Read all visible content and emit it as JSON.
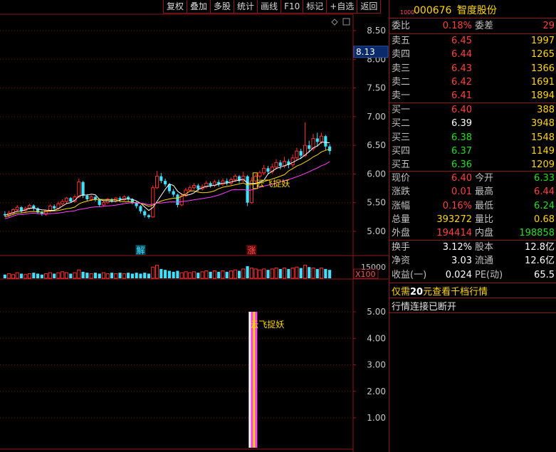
{
  "toolbar": {
    "buttons": [
      "复权",
      "叠加",
      "多股",
      "统计",
      "画线",
      "F10",
      "标记",
      "+自选",
      "返回"
    ]
  },
  "stock": {
    "code": "000676",
    "name": "智度股份",
    "small_label": "1000"
  },
  "order_book": {
    "weibi_label": "委比",
    "weibi_value": "0.18%",
    "weicha_label": "委差",
    "weicha_value": "29",
    "sells": [
      {
        "label": "卖五",
        "price": "6.45",
        "volume": "1997"
      },
      {
        "label": "卖四",
        "price": "6.44",
        "volume": "1265"
      },
      {
        "label": "卖三",
        "price": "6.43",
        "volume": "1366"
      },
      {
        "label": "卖二",
        "price": "6.42",
        "volume": "1691"
      },
      {
        "label": "卖一",
        "price": "6.41",
        "volume": "1894"
      }
    ],
    "buys": [
      {
        "label": "买一",
        "price": "6.40",
        "volume": "388",
        "color": "#ff4040"
      },
      {
        "label": "买二",
        "price": "6.39",
        "volume": "3948",
        "color": "#ffffff"
      },
      {
        "label": "买三",
        "price": "6.38",
        "volume": "1548",
        "color": "#20e020"
      },
      {
        "label": "买四",
        "price": "6.37",
        "volume": "1149",
        "color": "#20e020"
      },
      {
        "label": "买五",
        "price": "6.36",
        "volume": "1209",
        "color": "#20e020"
      }
    ]
  },
  "stats": [
    {
      "l1": "现价",
      "v1": "6.40",
      "c1": "#ff4040",
      "l2": "今开",
      "v2": "6.33",
      "c2": "#20e020"
    },
    {
      "l1": "涨跌",
      "v1": "0.01",
      "c1": "#ff4040",
      "l2": "最高",
      "v2": "6.44",
      "c2": "#ff4040"
    },
    {
      "l1": "涨幅",
      "v1": "0.16%",
      "c1": "#ff4040",
      "l2": "最低",
      "v2": "6.24",
      "c2": "#20e020"
    },
    {
      "l1": "总量",
      "v1": "393272",
      "c1": "#ffd700",
      "l2": "量比",
      "v2": "0.68",
      "c2": "#ffd700"
    },
    {
      "l1": "外盘",
      "v1": "194414",
      "c1": "#ff4040",
      "l2": "内盘",
      "v2": "198858",
      "c2": "#20e020"
    }
  ],
  "stats2": [
    {
      "l1": "换手",
      "v1": "3.12%",
      "l2": "股本",
      "v2": "12.8亿"
    },
    {
      "l1": "净资",
      "v1": "3.03",
      "l2": "流通",
      "v2": "12.6亿"
    },
    {
      "l1": "收益(一)",
      "v1": "0.024",
      "l2": "PE(动)",
      "v2": "65.5"
    }
  ],
  "notices": {
    "promo_prefix": "仅需",
    "promo_amount": "20",
    "promo_suffix": "元查看千档行情",
    "connection": "行情连接已断开"
  },
  "chart": {
    "price_ticks": [
      "8.50",
      "8.00",
      "7.50",
      "7.00",
      "6.50",
      "6.00",
      "5.50",
      "5.00"
    ],
    "cursor_price": "8.13",
    "volume_tick": "15000",
    "volume_multiplier": "X100",
    "indicator_ticks": [
      "5.00",
      "4.00",
      "3.00",
      "2.00",
      "1.00"
    ],
    "signal_label": "云飞捉妖",
    "marker_jie": "解",
    "marker_zhang": "涨"
  },
  "chart_data": {
    "type": "candlestick",
    "ylim": [
      4.9,
      8.6
    ],
    "candles": [
      [
        5.3,
        5.28,
        5.35,
        5.25
      ],
      [
        5.28,
        5.32,
        5.36,
        5.24
      ],
      [
        5.32,
        5.38,
        5.4,
        5.3
      ],
      [
        5.38,
        5.42,
        5.46,
        5.34
      ],
      [
        5.42,
        5.36,
        5.44,
        5.32
      ],
      [
        5.36,
        5.4,
        5.43,
        5.33
      ],
      [
        5.4,
        5.45,
        5.48,
        5.38
      ],
      [
        5.45,
        5.4,
        5.47,
        5.36
      ],
      [
        5.4,
        5.33,
        5.42,
        5.3
      ],
      [
        5.33,
        5.3,
        5.36,
        5.27
      ],
      [
        5.3,
        5.36,
        5.38,
        5.27
      ],
      [
        5.36,
        5.44,
        5.47,
        5.33
      ],
      [
        5.44,
        5.4,
        5.47,
        5.37
      ],
      [
        5.4,
        5.48,
        5.52,
        5.38
      ],
      [
        5.48,
        5.52,
        5.56,
        5.45
      ],
      [
        5.52,
        5.58,
        5.6,
        5.49
      ],
      [
        5.58,
        5.52,
        5.6,
        5.5
      ],
      [
        5.52,
        5.6,
        5.64,
        5.5
      ],
      [
        5.6,
        5.86,
        5.92,
        5.58
      ],
      [
        5.86,
        5.62,
        5.88,
        5.58
      ],
      [
        5.62,
        5.56,
        5.65,
        5.52
      ],
      [
        5.56,
        5.6,
        5.63,
        5.53
      ],
      [
        5.6,
        5.55,
        5.62,
        5.52
      ],
      [
        5.55,
        5.46,
        5.57,
        5.43
      ],
      [
        5.46,
        5.5,
        5.53,
        5.44
      ],
      [
        5.5,
        5.56,
        5.58,
        5.48
      ],
      [
        5.56,
        5.53,
        5.58,
        5.5
      ],
      [
        5.53,
        5.58,
        5.6,
        5.5
      ],
      [
        5.58,
        5.55,
        5.61,
        5.52
      ],
      [
        5.55,
        5.6,
        5.63,
        5.53
      ],
      [
        5.6,
        5.56,
        5.62,
        5.52
      ],
      [
        5.56,
        5.5,
        5.58,
        5.47
      ],
      [
        5.5,
        5.44,
        5.52,
        5.4
      ],
      [
        5.44,
        5.35,
        5.46,
        5.31
      ],
      [
        5.35,
        5.28,
        5.38,
        5.24
      ],
      [
        5.28,
        5.25,
        5.3,
        5.22
      ],
      [
        5.25,
        5.76,
        5.8,
        5.24
      ],
      [
        5.76,
        5.96,
        6.05,
        5.74
      ],
      [
        5.96,
        5.88,
        6.02,
        5.84
      ],
      [
        5.88,
        5.82,
        5.92,
        5.78
      ],
      [
        5.82,
        5.7,
        5.84,
        5.66
      ],
      [
        5.7,
        5.64,
        5.74,
        5.6
      ],
      [
        5.64,
        5.46,
        5.66,
        5.42
      ],
      [
        5.46,
        5.62,
        5.66,
        5.44
      ],
      [
        5.62,
        5.72,
        5.76,
        5.6
      ],
      [
        5.72,
        5.76,
        5.8,
        5.7
      ],
      [
        5.76,
        5.8,
        5.84,
        5.73
      ],
      [
        5.8,
        5.74,
        5.83,
        5.7
      ],
      [
        5.74,
        5.78,
        5.82,
        5.71
      ],
      [
        5.78,
        5.84,
        5.88,
        5.75
      ],
      [
        5.84,
        5.8,
        5.87,
        5.76
      ],
      [
        5.8,
        5.86,
        5.9,
        5.77
      ],
      [
        5.86,
        5.82,
        5.9,
        5.78
      ],
      [
        5.82,
        5.88,
        5.92,
        5.79
      ],
      [
        5.88,
        5.84,
        5.92,
        5.8
      ],
      [
        5.84,
        5.9,
        5.94,
        5.81
      ],
      [
        5.9,
        5.96,
        6.0,
        5.86
      ],
      [
        5.96,
        5.88,
        5.98,
        5.84
      ],
      [
        5.88,
        5.96,
        6.04,
        5.86
      ],
      [
        5.96,
        5.5,
        5.98,
        5.44
      ],
      [
        5.5,
        5.88,
        5.94,
        5.48
      ],
      [
        5.88,
        5.96,
        6.0,
        5.84
      ],
      [
        5.96,
        6.02,
        6.06,
        5.92
      ],
      [
        6.02,
        6.1,
        6.16,
        5.98
      ],
      [
        6.1,
        6.04,
        6.14,
        6.0
      ],
      [
        6.04,
        6.12,
        6.18,
        6.0
      ],
      [
        6.12,
        6.2,
        6.26,
        6.08
      ],
      [
        6.2,
        6.14,
        6.24,
        6.08
      ],
      [
        6.14,
        6.22,
        6.3,
        6.1
      ],
      [
        6.22,
        6.16,
        6.26,
        6.1
      ],
      [
        6.16,
        6.28,
        6.34,
        6.12
      ],
      [
        6.28,
        6.4,
        6.46,
        6.24
      ],
      [
        6.4,
        6.32,
        6.44,
        6.26
      ],
      [
        6.32,
        6.5,
        6.9,
        6.3
      ],
      [
        6.5,
        6.44,
        6.58,
        6.38
      ],
      [
        6.44,
        6.62,
        6.7,
        6.4
      ],
      [
        6.62,
        6.56,
        6.72,
        6.48
      ],
      [
        6.56,
        6.66,
        6.72,
        6.52
      ],
      [
        6.66,
        6.48,
        6.68,
        6.42
      ],
      [
        6.48,
        6.4,
        6.52,
        6.34
      ]
    ],
    "volumes": [
      4,
      5,
      4,
      6,
      5,
      4,
      5,
      6,
      5,
      4,
      5,
      6,
      5,
      6,
      7,
      6,
      5,
      6,
      9,
      7,
      6,
      5,
      6,
      5,
      6,
      5,
      6,
      5,
      6,
      5,
      6,
      5,
      6,
      5,
      6,
      5,
      12,
      14,
      10,
      9,
      8,
      7,
      8,
      6,
      7,
      6,
      7,
      6,
      7,
      8,
      7,
      8,
      7,
      8,
      7,
      8,
      9,
      8,
      10,
      13,
      11,
      10,
      9,
      10,
      9,
      10,
      11,
      10,
      11,
      10,
      11,
      12,
      11,
      14,
      12,
      11,
      10,
      11,
      10,
      9
    ],
    "signal": {
      "index": 60,
      "value": 5.0
    },
    "indicator_ylim": [
      0,
      5.4
    ]
  }
}
